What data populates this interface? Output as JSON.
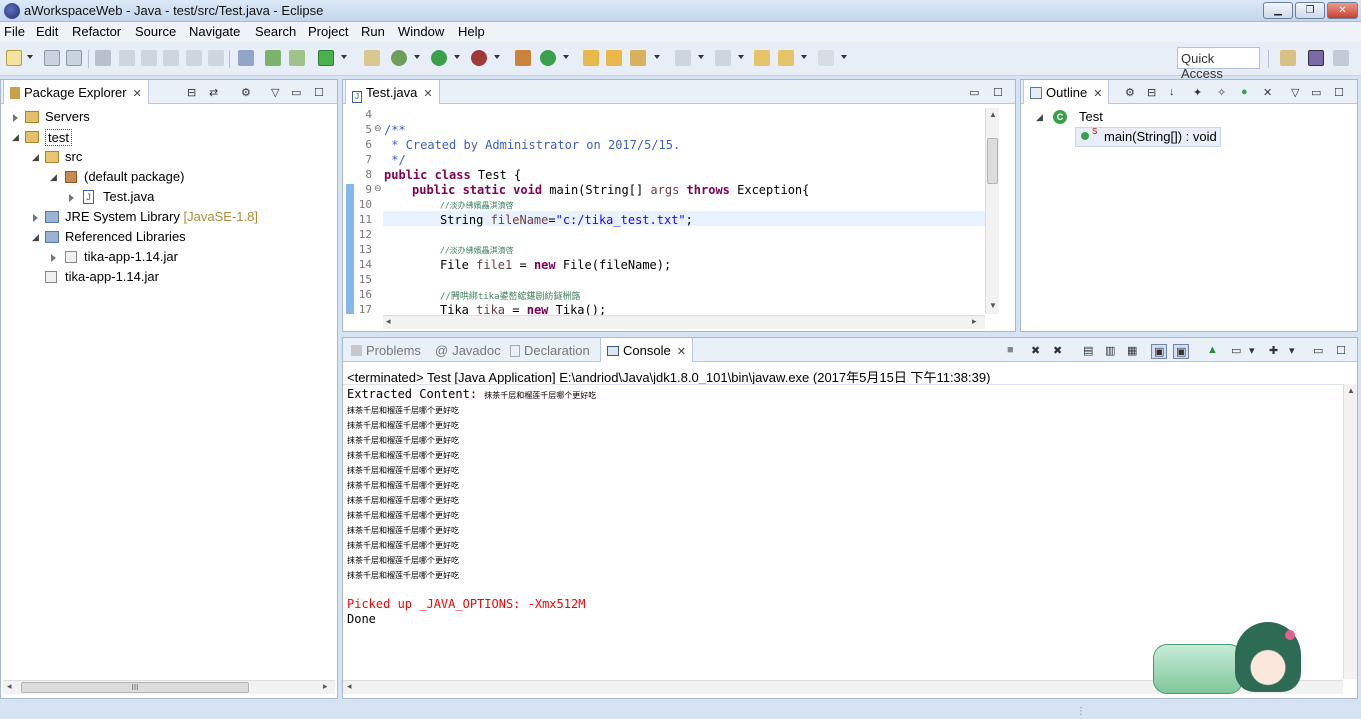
{
  "window": {
    "title": "aWorkspaceWeb - Java - test/src/Test.java - Eclipse"
  },
  "menu": [
    "File",
    "Edit",
    "Refactor",
    "Source",
    "Navigate",
    "Search",
    "Project",
    "Run",
    "Window",
    "Help"
  ],
  "quick_access": "Quick Access",
  "package_explorer": {
    "tab": "Package Explorer",
    "tree": [
      {
        "label": "Servers",
        "decor": ""
      },
      {
        "label": "test",
        "decor": ""
      },
      {
        "label": "src",
        "decor": ""
      },
      {
        "label": "(default package)",
        "decor": ""
      },
      {
        "label": "Test.java",
        "decor": ""
      },
      {
        "label": "JRE System Library",
        "decor": "[JavaSE-1.8]"
      },
      {
        "label": "Referenced Libraries",
        "decor": ""
      },
      {
        "label": "tika-app-1.14.jar",
        "decor": ""
      },
      {
        "label": "tika-app-1.14.jar",
        "decor": ""
      }
    ],
    "hscroll_label": "III"
  },
  "editor": {
    "tab": "Test.java",
    "line_numbers": [
      "4",
      "5",
      "6",
      "7",
      "8",
      "9",
      "10",
      "11",
      "12",
      "13",
      "14",
      "15",
      "16",
      "17"
    ],
    "lines": {
      "l5": "/**",
      "l6": " * Created by Administrator on 2017/5/15.",
      "l7": " */",
      "l8_kw": "public class",
      "l8_rest": " Test {",
      "l9_kw": "public static void",
      "l9_mid": " main(String[] ",
      "l9_arg": "args",
      "l9_kw2": " throws",
      "l9_rest": " Exception{",
      "l10": "//淡办绋嬪畾淇濆啓",
      "l11_a": "String ",
      "l11_var": "fileName",
      "l11_eq": "=",
      "l11_str": "\"c:/tika_test.txt\"",
      "l11_end": ";",
      "l13": "//淡办绋嬪畾淇濆啓",
      "l14_a": "File ",
      "l14_var": "file1",
      "l14_eq": " = ",
      "l14_kw": "new",
      "l14_end": " File(fileName);",
      "l16": "//闁哄綁tika鍙嶅綋鍖剧紡鐩栦簬",
      "l17_a": "Tika ",
      "l17_var": "tika",
      "l17_eq": " = ",
      "l17_kw": "new",
      "l17_end": " Tika();"
    }
  },
  "outline": {
    "tab": "Outline",
    "class_name": "Test",
    "method": "main(String[]) : void",
    "method_modifier": "S"
  },
  "bottom_tabs": {
    "problems": "Problems",
    "javadoc": "Javadoc",
    "declaration": "Declaration",
    "console": "Console"
  },
  "console": {
    "header": "<terminated> Test [Java Application] E:\\andriod\\Java\\jdk1.8.0_101\\bin\\javaw.exe (2017年5月15日 下午11:38:39)",
    "extracted_prefix": "Extracted Content: ",
    "extracted_text": "抹茶千层和榴莲千层哪个更好吃",
    "repeated_lines": [
      "抹茶千层和榴莲千层哪个更好吃",
      "抹茶千层和榴莲千层哪个更好吃",
      "抹茶千层和榴莲千层哪个更好吃",
      "抹茶千层和榴莲千层哪个更好吃",
      "抹茶千层和榴莲千层哪个更好吃",
      "抹茶千层和榴莲千层哪个更好吃",
      "抹茶千层和榴莲千层哪个更好吃",
      "抹茶千层和榴莲千层哪个更好吃",
      "抹茶千层和榴莲千层哪个更好吃",
      "抹茶千层和榴莲千层哪个更好吃",
      "抹茶千层和榴莲千层哪个更好吃",
      "抹茶千层和榴莲千层哪个更好吃"
    ],
    "java_options": "Picked up _JAVA_OPTIONS: -Xmx512M",
    "done": "Done"
  },
  "colors": {
    "keyword": "#7f0055",
    "comment": "#3f5fbf",
    "string": "#2a00ff",
    "stderr": "#ff0000",
    "decoration": "#b08b3a",
    "selection_bar": "#5aa0e0"
  }
}
